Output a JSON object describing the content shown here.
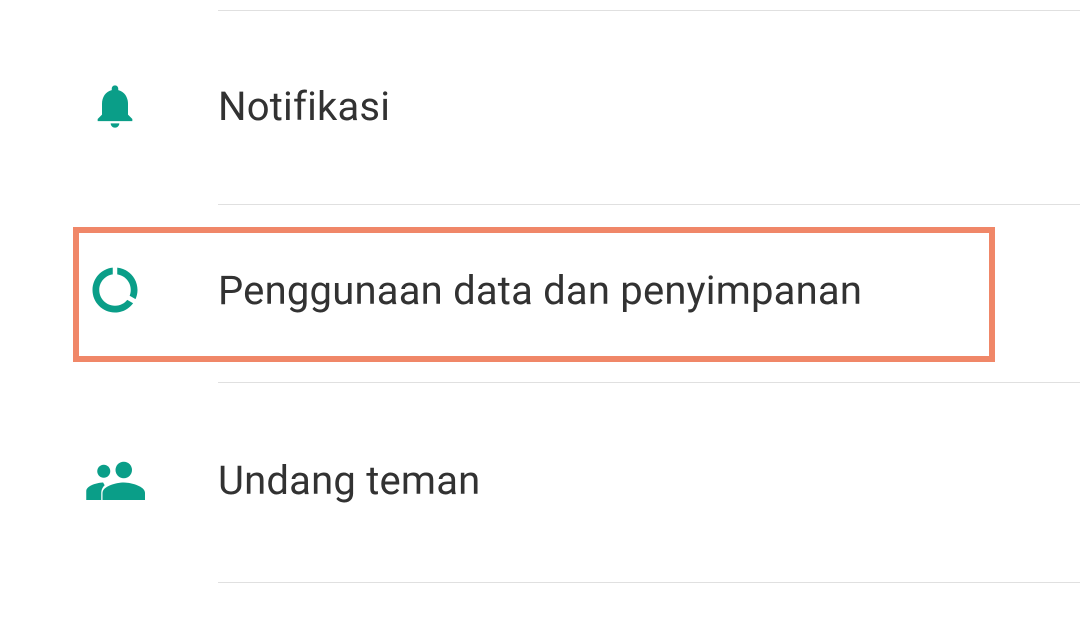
{
  "menu": {
    "notifications": {
      "label": "Notifikasi",
      "icon": "bell-icon"
    },
    "dataUsage": {
      "label": "Penggunaan data dan penyimpanan",
      "icon": "data-usage-icon"
    },
    "invite": {
      "label": "Undang teman",
      "icon": "people-icon"
    }
  },
  "colors": {
    "accent": "#0a9e88",
    "highlight": "#f08768",
    "text": "#323232",
    "divider": "#e0e0e0"
  }
}
